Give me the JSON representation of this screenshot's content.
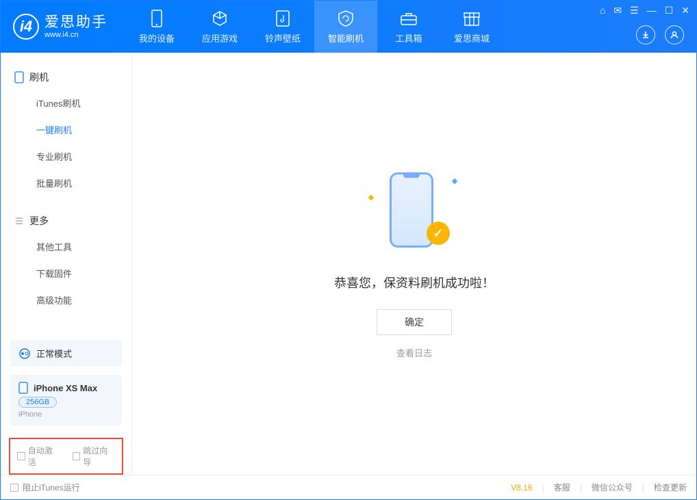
{
  "app": {
    "title": "爱思助手",
    "subtitle": "www.i4.cn"
  },
  "nav": {
    "items": [
      {
        "label": "我的设备"
      },
      {
        "label": "应用游戏"
      },
      {
        "label": "铃声壁纸"
      },
      {
        "label": "智能刷机"
      },
      {
        "label": "工具箱"
      },
      {
        "label": "爱思商城"
      }
    ]
  },
  "sidebar": {
    "section_flash": "刷机",
    "items_flash": [
      "iTunes刷机",
      "一键刷机",
      "专业刷机",
      "批量刷机"
    ],
    "section_more": "更多",
    "items_more": [
      "其他工具",
      "下载固件",
      "高级功能"
    ]
  },
  "status": {
    "mode_label": "正常模式"
  },
  "device": {
    "name": "iPhone XS Max",
    "capacity": "256GB",
    "type": "iPhone"
  },
  "options": {
    "auto_activate": "自动激活",
    "skip_guide": "跳过向导"
  },
  "main": {
    "success_message": "恭喜您，保资料刷机成功啦！",
    "ok_button": "确定",
    "view_log": "查看日志"
  },
  "footer": {
    "block_itunes": "阻止iTunes运行",
    "version": "V8.16",
    "support": "客服",
    "wechat": "微信公众号",
    "check_update": "检查更新"
  }
}
